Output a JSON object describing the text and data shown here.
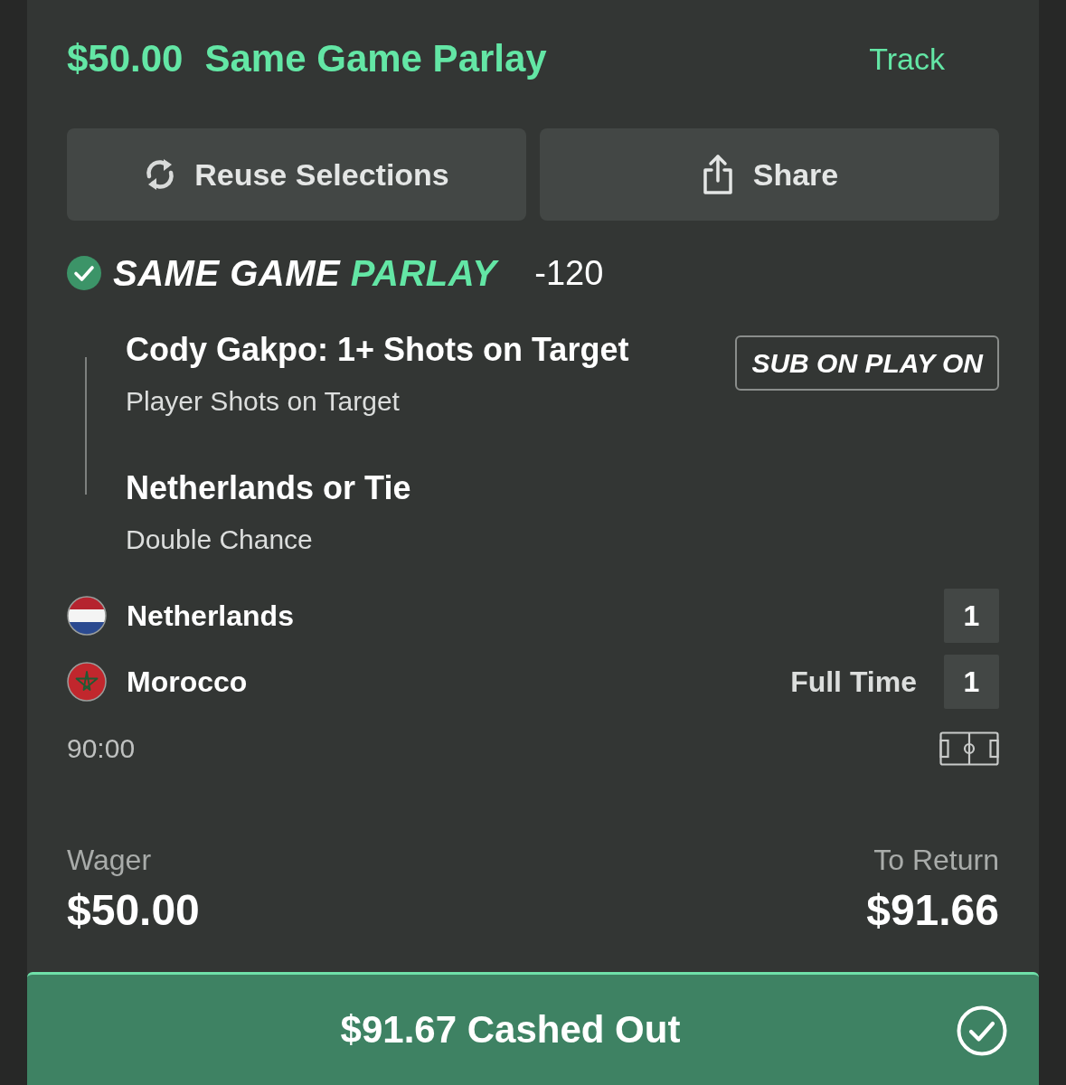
{
  "header": {
    "stake": "$50.00",
    "title": "Same Game Parlay",
    "track": "Track"
  },
  "actions": [
    {
      "kind": "reuse",
      "label": "Reuse Selections"
    },
    {
      "kind": "share",
      "label": "Share"
    }
  ],
  "parlay": {
    "settled": true,
    "brand_plain": "SAME GAME",
    "brand_accent": "PARLAY",
    "odds": "-120",
    "legs": [
      {
        "title": "Cody Gakpo: 1+ Shots on Target",
        "market": "Player Shots on Target",
        "badge": "SUB ON PLAY ON"
      },
      {
        "title": "Netherlands or Tie",
        "market": "Double Chance"
      }
    ]
  },
  "match": {
    "teams": [
      {
        "kind": "netherlands",
        "name": "Netherlands",
        "score": "1"
      },
      {
        "kind": "morocco",
        "name": "Morocco",
        "status": "Full Time",
        "score": "1"
      }
    ],
    "clock": "90:00"
  },
  "totals": {
    "wager_label": "Wager",
    "wager": "$50.00",
    "return_label": "To Return",
    "return": "$91.66"
  },
  "cashout": {
    "label": "$91.67 Cashed Out",
    "done": true
  }
}
